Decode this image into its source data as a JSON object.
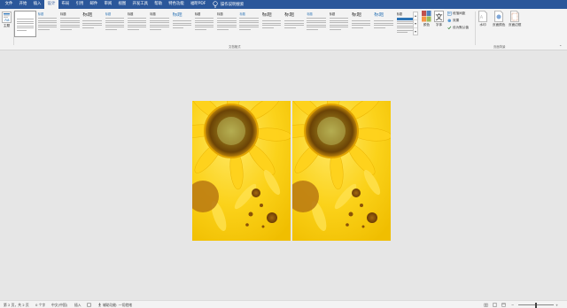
{
  "tabs": [
    {
      "label": "文件",
      "active": false
    },
    {
      "label": "开始",
      "active": false
    },
    {
      "label": "插入",
      "active": false
    },
    {
      "label": "设计",
      "active": true
    },
    {
      "label": "布局",
      "active": false
    },
    {
      "label": "引用",
      "active": false
    },
    {
      "label": "邮件",
      "active": false
    },
    {
      "label": "审阅",
      "active": false
    },
    {
      "label": "视图",
      "active": false
    },
    {
      "label": "开发工具",
      "active": false
    },
    {
      "label": "帮助",
      "active": false
    },
    {
      "label": "特色功能",
      "active": false
    },
    {
      "label": "福昕PDF",
      "active": false
    }
  ],
  "tell_me": "操作说明搜索",
  "ribbon": {
    "theme_label": "主题",
    "doc_format_group": "文档格式",
    "page_bg_group": "页面背景",
    "colors_label": "颜色",
    "fonts_label": "字体",
    "paragraph_spacing": "段落间距",
    "effects": "效果",
    "set_default": "设为默认值",
    "watermark": "水印",
    "page_color": "页面颜色",
    "page_borders": "页面边框",
    "gallery_titles": [
      "",
      "标题",
      "标题",
      "标题",
      "标题",
      "标题",
      "标题",
      "标题",
      "标题",
      "标题",
      "标题",
      "标题",
      "标题",
      "标题",
      "标题",
      "标题",
      "标题",
      "标题"
    ]
  },
  "status": {
    "page": "第 2 页，共 2 页",
    "words": "0 个字",
    "language": "中文(中国)",
    "insert_mode": "插入",
    "accessibility": "辅助功能: 一切就绪"
  },
  "colors": {
    "tab_bar": "#2b579a",
    "ribbon": "#f3f3f3",
    "canvas": "#e6e6e6",
    "accent_blue": "#2e75b6"
  }
}
